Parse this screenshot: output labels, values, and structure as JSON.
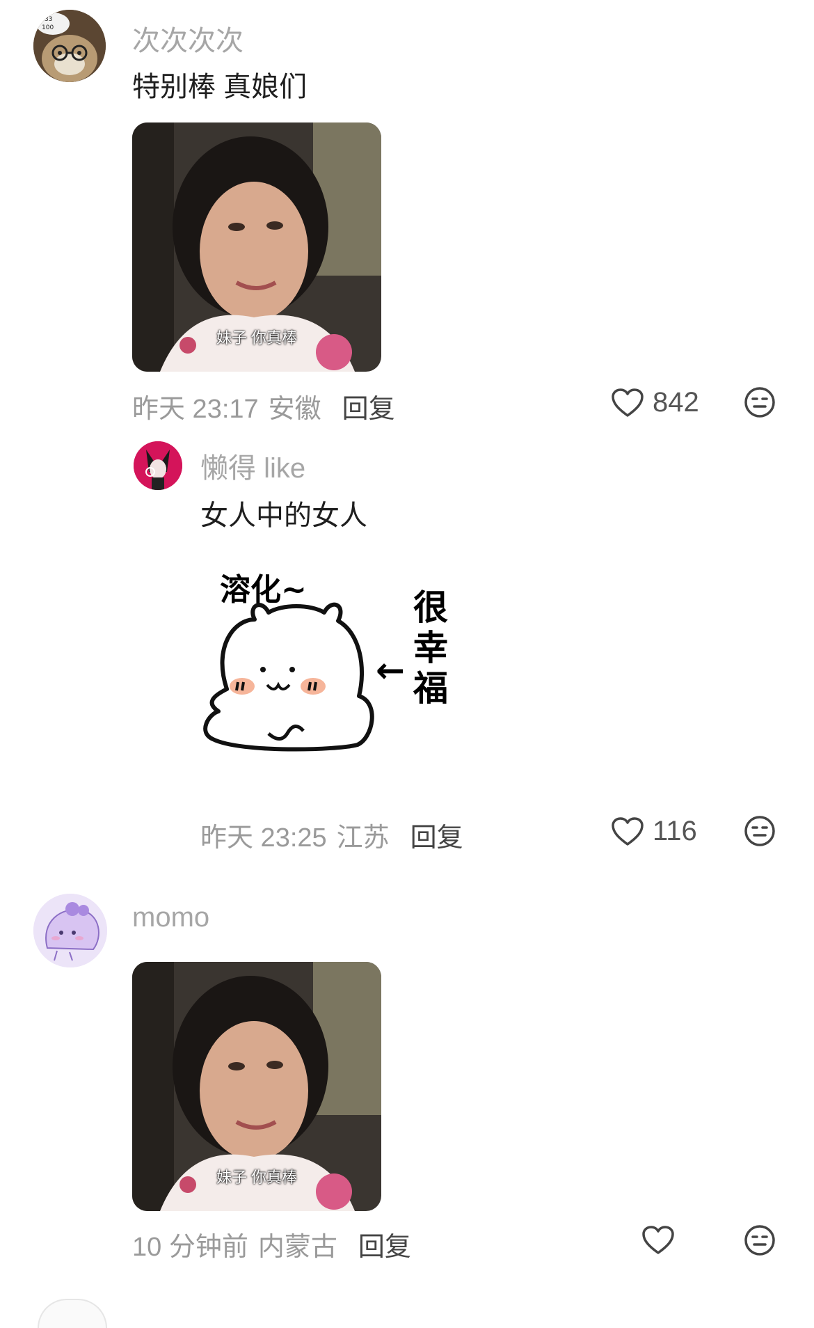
{
  "comments": [
    {
      "username": "次次次次",
      "text": "特别棒 真娘们",
      "image_subtitle": "妹子 你真棒",
      "time": "昨天 23:17",
      "location": "安徽",
      "reply_label": "回复",
      "likes": "842",
      "avatar_badge": [
        "33",
        "100"
      ]
    },
    {
      "username": "懒得 like",
      "text": "女人中的女人",
      "sticker": {
        "top_text": "溶化~",
        "side_text": [
          "很",
          "幸",
          "福"
        ],
        "arrow": "←"
      },
      "time": "昨天 23:25",
      "location": "江苏",
      "reply_label": "回复",
      "likes": "116"
    },
    {
      "username": "momo",
      "text": "",
      "image_subtitle": "妹子 你真棒",
      "time": "10 分钟前",
      "location": "内蒙古",
      "reply_label": "回复",
      "likes": ""
    }
  ],
  "colors": {
    "username": "#a6a6a6",
    "text": "#1f1f1f",
    "meta": "#9a9a9a",
    "avatar2_bg": "#d4145a",
    "avatar3_bg": "#ece4f8"
  }
}
